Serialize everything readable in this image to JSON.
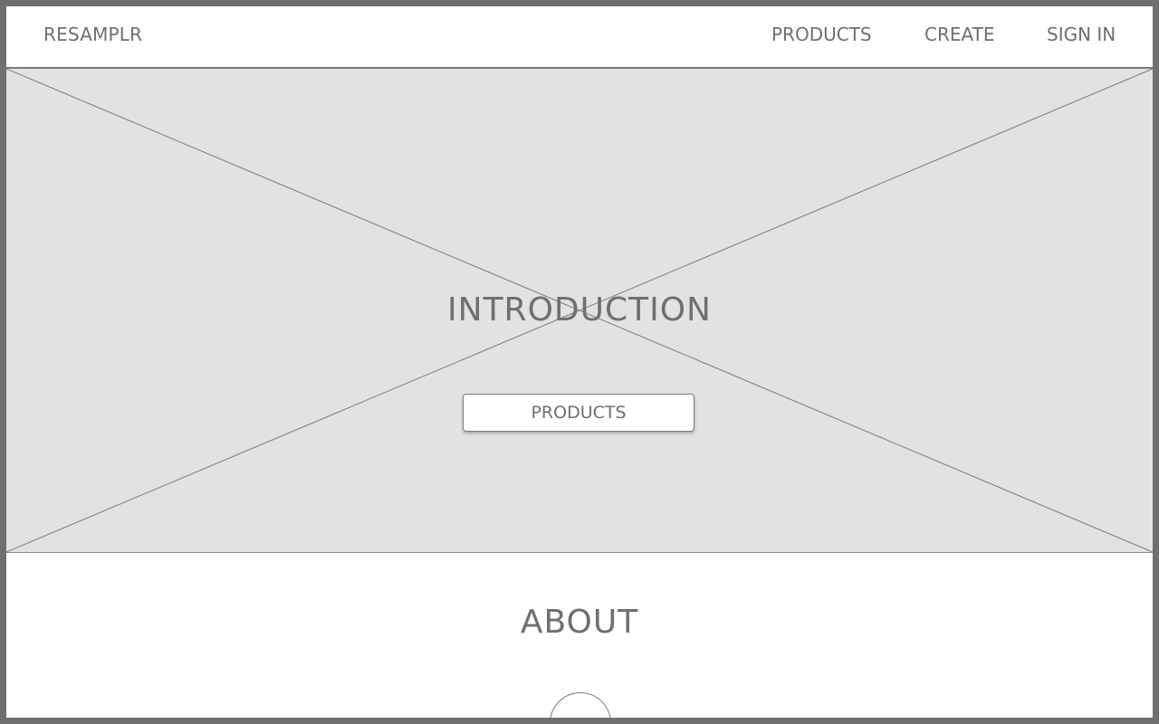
{
  "header": {
    "logo": "RESAMPLR",
    "nav": {
      "products": "PRODUCTS",
      "create": "CREATE",
      "sign_in": "SIGN IN"
    }
  },
  "hero": {
    "title": "INTRODUCTION",
    "button_label": "PRODUCTS",
    "placeholder_color": "#e2e2e2"
  },
  "about": {
    "title": "ABOUT"
  },
  "colors": {
    "text": "#6f6f6f",
    "frame": "#6f6f6f",
    "background": "#ffffff"
  }
}
